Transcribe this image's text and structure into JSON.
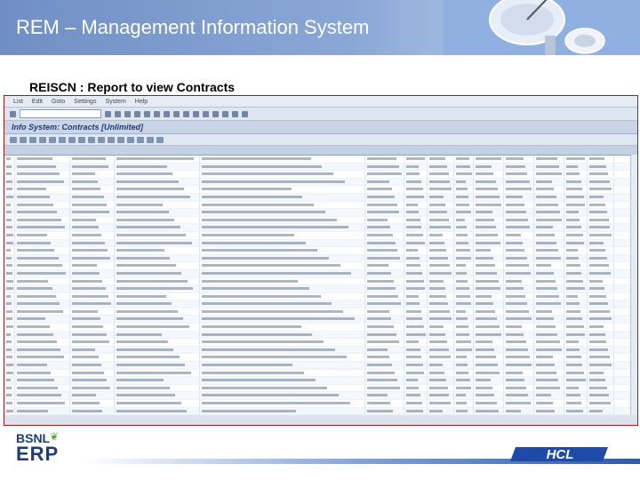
{
  "slide": {
    "title": "REM – Management Information System",
    "subtitle": "REISCN : Report to view Contracts"
  },
  "sap": {
    "menu": [
      "List",
      "Edit",
      "Goto",
      "Settings",
      "System",
      "Help"
    ],
    "window_title": "Info System: Contracts [Unlimited]"
  },
  "logos": {
    "bsnl": "BSNL",
    "erp": "ERP",
    "hcl": "HCL"
  },
  "colors": {
    "header_blue": "#7f9fd0",
    "frame_red": "#9e1b22",
    "hcl_blue": "#1f4aa8"
  }
}
